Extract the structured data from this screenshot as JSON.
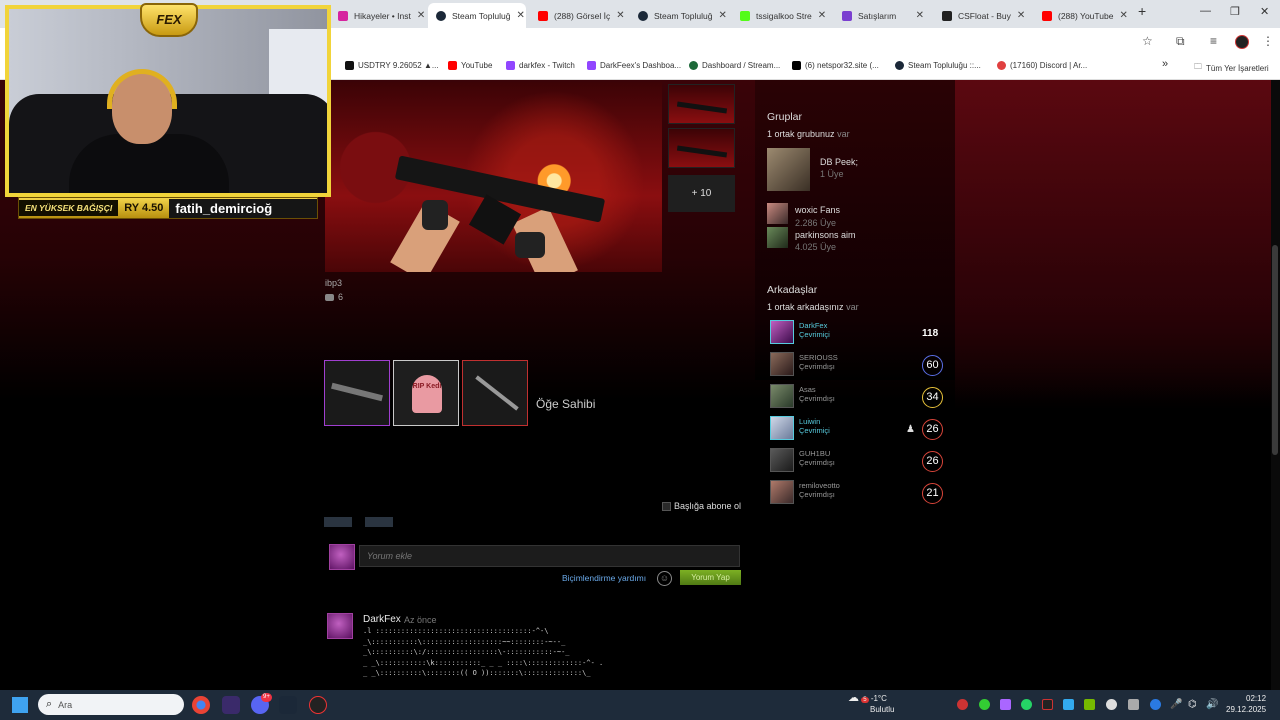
{
  "browser": {
    "tabs": [
      {
        "label": "Hikayeler • Inst",
        "color": "#d6249f"
      },
      {
        "label": "Steam Topluluğ",
        "color": "#1b2838"
      },
      {
        "label": "(288) Görsel İç",
        "color": "#ff0000"
      },
      {
        "label": "Steam Topluluğ",
        "color": "#1b2838"
      },
      {
        "label": "tssigalkoo Stre",
        "color": "#53fc18"
      },
      {
        "label": "Satışlarım",
        "color": "#7a3fd0"
      },
      {
        "label": "CSFloat - Buy",
        "color": "#222222"
      },
      {
        "label": "(288) YouTube",
        "color": "#ff0000"
      }
    ],
    "new_tab": "+",
    "bookmarks": [
      {
        "label": "USDTRY 9.26052 ▲...",
        "color": "#111111"
      },
      {
        "label": "YouTube",
        "color": "#ff0000"
      },
      {
        "label": "darkfex - Twitch",
        "color": "#9146ff"
      },
      {
        "label": "DarkFeex's Dashboa...",
        "color": "#9146ff"
      },
      {
        "label": "Dashboard / Stream...",
        "color": "#1e6a3a"
      },
      {
        "label": "(6) netspor32.site (...",
        "color": "#000000"
      },
      {
        "label": "Steam Topluluğu ::...",
        "color": "#1b2838"
      },
      {
        "label": "(17160) Discord | Ar...",
        "color": "#e04040"
      }
    ],
    "bookmarks_more": "»",
    "all_bookmarks": "Tüm Yer İşaretleri"
  },
  "overlay": {
    "logo_text": "FEX",
    "donation_label": "EN YÜKSEK BAĞIŞÇI",
    "donation_amount": "RY 4.50",
    "donation_name": "fatih_demircioğ"
  },
  "showcase": {
    "more_label": "+ 10",
    "caption": "ibp3",
    "comment_count": "6"
  },
  "items": {
    "sticker_text": "RIP Kedi",
    "owner_label": "Öğe Sahibi"
  },
  "comments": {
    "subscribe_label": "Başlığa abone ol",
    "input_placeholder": "Yorum ekle",
    "format_help": "Biçimlendirme yardımı",
    "post_button": "Yorum Yap",
    "entry": {
      "author": "DarkFex",
      "time": "Az önce",
      "ascii_lines": [
        ".l :::::::::::::::::::::::::::::::::::::-^-\\",
        "_\\:::::::::::\\:::::::::::::::::::~~::::::::-~--_",
        "_\\::::::::::\\:/:::::::::::::::::\\-:::::::::::-~-_",
        "_ _\\:::::::::::\\k:::::::::::_ _ _ ::::\\:::::::::::::-^- .",
        "_ _\\::::::::::\\::::::::(( O )):::::::\\::::::::::::::\\_"
      ]
    }
  },
  "sidebar": {
    "groups_title": "Gruplar",
    "groups_common_count": "1 ortak grubunuz",
    "groups_common_suffix": "var",
    "groups": [
      {
        "name": "DB Peek;",
        "members": "1 Üye"
      },
      {
        "name": "woxic Fans",
        "members": "2.286 Üye"
      },
      {
        "name": "parkinsons aim",
        "members": "4.025 Üye"
      }
    ],
    "friends_title": "Arkadaşlar",
    "friends_common_count": "1 ortak arkadaşınız",
    "friends_common_suffix": "var",
    "friends": [
      {
        "name": "DarkFex",
        "status": "Çevrimiçi",
        "level": "118",
        "level_color": "#ffffff",
        "avatar_color": "#8a2a9a"
      },
      {
        "name": "SERIOUSS",
        "status": "Çevrimdışı",
        "level": "60",
        "level_color": "#5a6fe8",
        "avatar_color": "#6a4a3a"
      },
      {
        "name": "Asas",
        "status": "Çevrimdışı",
        "level": "34",
        "level_color": "#e8c23a",
        "avatar_color": "#5a6a4a"
      },
      {
        "name": "Luiwin",
        "status": "Çevrimiçi",
        "level": "26",
        "level_color": "#d9453a",
        "avatar_color": "#a8b8d8"
      },
      {
        "name": "GUH1BU",
        "status": "Çevrimdışı",
        "level": "26",
        "level_color": "#d9453a",
        "avatar_color": "#3a3a3a"
      },
      {
        "name": "remiloveotto",
        "status": "Çevrimdışı",
        "level": "21",
        "level_color": "#d9453a",
        "avatar_color": "#8a5a4a"
      }
    ]
  },
  "taskbar": {
    "search_placeholder": "Ara",
    "weather_badge": "5",
    "weather_temp": "-1°C",
    "weather_desc": "Bulutlu",
    "time": "02:12",
    "date": "29.12.2025",
    "discord_badge": "9+"
  }
}
